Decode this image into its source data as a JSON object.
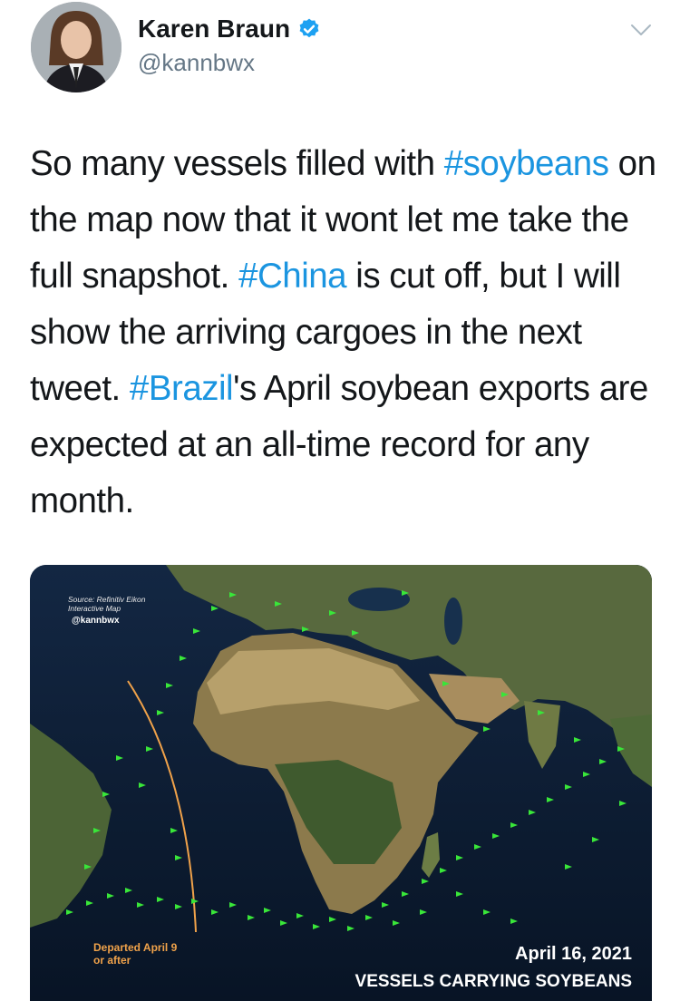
{
  "tweet": {
    "author": {
      "display_name": "Karen Braun",
      "handle": "@kannbwx",
      "verified": true,
      "avatar_icon": "profile-photo"
    },
    "menu_icon": "chevron-down-icon",
    "text_parts": {
      "p1": "So many vessels filled with ",
      "tag_soybeans": "#soybeans",
      "p2": " on the map now that it wont let me take the full snapshot. ",
      "tag_china": "#China",
      "p3": " is cut off, but I will show the arriving cargoes in the next tweet. ",
      "tag_brazil": "#Brazil",
      "p4": "'s April soybean exports are expected at an all-time record for any month."
    },
    "colors": {
      "text": "#14171a",
      "secondary": "#657786",
      "link": "#1b95e0",
      "verified_badge": "#1da1f2",
      "vessel_marker": "#39e639",
      "route_line": "#f0a24a"
    }
  },
  "media": {
    "source_line1": "Source: Refinitiv Eikon",
    "source_line2": "Interactive Map",
    "watermark": "@kannbwx",
    "route_label_line1": "Departed April 9",
    "route_label_line2": "or after",
    "date": "April 16, 2021",
    "caption": "VESSELS CARRYING SOYBEANS"
  }
}
